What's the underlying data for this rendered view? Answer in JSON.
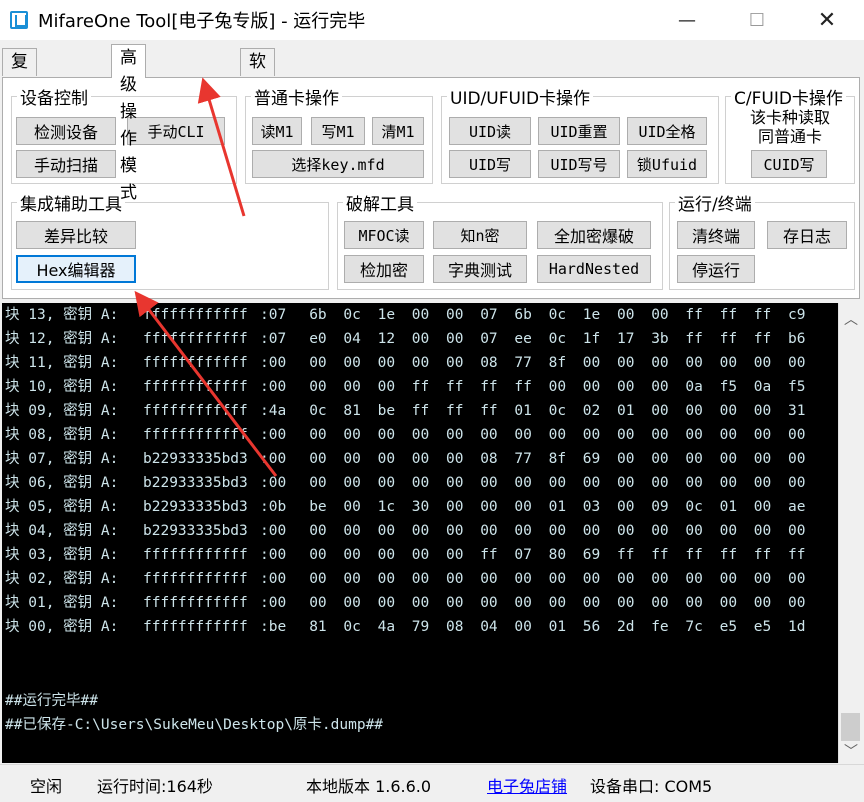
{
  "window": {
    "title": "MifareOne Tool[电子兔专版] - 运行完毕",
    "minimize": "—",
    "maximize": "☐",
    "close": "✕"
  },
  "tabs": [
    {
      "label": "复制卡模式"
    },
    {
      "label": "高级操作模式"
    },
    {
      "label": "软件设置"
    }
  ],
  "groups": {
    "device": {
      "title": "设备控制",
      "buttons": [
        "检测设备",
        "手动CLI",
        "手动扫描"
      ]
    },
    "normal": {
      "title": "普通卡操作",
      "buttons": [
        "读M1",
        "写M1",
        "清M1",
        "选择key.mfd"
      ]
    },
    "uid": {
      "title": "UID/UFUID卡操作",
      "buttons": [
        "UID读",
        "UID重置",
        "UID全格",
        "UID写",
        "UID写号",
        "锁Ufuid"
      ]
    },
    "cfuid": {
      "title": "C/FUID卡操作",
      "note_line1": "该卡种读取",
      "note_line2": "同普通卡",
      "button": "CUID写"
    },
    "tools": {
      "title": "集成辅助工具",
      "buttons": [
        "差异比较",
        "Hex编辑器"
      ]
    },
    "crack": {
      "title": "破解工具",
      "buttons": [
        "MFOC读",
        "知n密",
        "全加密爆破",
        "检加密",
        "字典测试",
        "HardNested"
      ]
    },
    "run": {
      "title": "运行/终端",
      "buttons": [
        "清终端",
        "存日志",
        "停运行"
      ]
    }
  },
  "console": {
    "rows": [
      {
        "label": "块 13, 密钥 A:",
        "key": "ffffffffffff",
        "bytes": [
          ":07",
          "6b",
          "0c",
          "1e",
          "00",
          "00",
          "07",
          "6b",
          "0c",
          "1e",
          "00",
          "00",
          "ff",
          "ff",
          "ff",
          "c9"
        ]
      },
      {
        "label": "块 12, 密钥 A:",
        "key": "ffffffffffff",
        "bytes": [
          ":07",
          "e0",
          "04",
          "12",
          "00",
          "00",
          "07",
          "ee",
          "0c",
          "1f",
          "17",
          "3b",
          "ff",
          "ff",
          "ff",
          "b6"
        ]
      },
      {
        "label": "块 11, 密钥 A:",
        "key": "ffffffffffff",
        "bytes": [
          ":00",
          "00",
          "00",
          "00",
          "00",
          "00",
          "08",
          "77",
          "8f",
          "00",
          "00",
          "00",
          "00",
          "00",
          "00",
          "00"
        ]
      },
      {
        "label": "块 10, 密钥 A:",
        "key": "ffffffffffff",
        "bytes": [
          ":00",
          "00",
          "00",
          "00",
          "ff",
          "ff",
          "ff",
          "ff",
          "00",
          "00",
          "00",
          "00",
          "0a",
          "f5",
          "0a",
          "f5"
        ]
      },
      {
        "label": "块 09, 密钥 A:",
        "key": "ffffffffffff",
        "bytes": [
          ":4a",
          "0c",
          "81",
          "be",
          "ff",
          "ff",
          "ff",
          "01",
          "0c",
          "02",
          "01",
          "00",
          "00",
          "00",
          "00",
          "31"
        ]
      },
      {
        "label": "块 08, 密钥 A:",
        "key": "ffffffffffff",
        "bytes": [
          ":00",
          "00",
          "00",
          "00",
          "00",
          "00",
          "00",
          "00",
          "00",
          "00",
          "00",
          "00",
          "00",
          "00",
          "00",
          "00"
        ]
      },
      {
        "label": "块 07, 密钥 A:",
        "key": "b22933335bd3",
        "bytes": [
          ":00",
          "00",
          "00",
          "00",
          "00",
          "00",
          "08",
          "77",
          "8f",
          "69",
          "00",
          "00",
          "00",
          "00",
          "00",
          "00"
        ]
      },
      {
        "label": "块 06, 密钥 A:",
        "key": "b22933335bd3",
        "bytes": [
          ":00",
          "00",
          "00",
          "00",
          "00",
          "00",
          "00",
          "00",
          "00",
          "00",
          "00",
          "00",
          "00",
          "00",
          "00",
          "00"
        ]
      },
      {
        "label": "块 05, 密钥 A:",
        "key": "b22933335bd3",
        "bytes": [
          ":0b",
          "be",
          "00",
          "1c",
          "30",
          "00",
          "00",
          "00",
          "01",
          "03",
          "00",
          "09",
          "0c",
          "01",
          "00",
          "ae"
        ]
      },
      {
        "label": "块 04, 密钥 A:",
        "key": "b22933335bd3",
        "bytes": [
          ":00",
          "00",
          "00",
          "00",
          "00",
          "00",
          "00",
          "00",
          "00",
          "00",
          "00",
          "00",
          "00",
          "00",
          "00",
          "00"
        ]
      },
      {
        "label": "块 03, 密钥 A:",
        "key": "ffffffffffff",
        "bytes": [
          ":00",
          "00",
          "00",
          "00",
          "00",
          "00",
          "ff",
          "07",
          "80",
          "69",
          "ff",
          "ff",
          "ff",
          "ff",
          "ff",
          "ff"
        ]
      },
      {
        "label": "块 02, 密钥 A:",
        "key": "ffffffffffff",
        "bytes": [
          ":00",
          "00",
          "00",
          "00",
          "00",
          "00",
          "00",
          "00",
          "00",
          "00",
          "00",
          "00",
          "00",
          "00",
          "00",
          "00"
        ]
      },
      {
        "label": "块 01, 密钥 A:",
        "key": "ffffffffffff",
        "bytes": [
          ":00",
          "00",
          "00",
          "00",
          "00",
          "00",
          "00",
          "00",
          "00",
          "00",
          "00",
          "00",
          "00",
          "00",
          "00",
          "00"
        ]
      },
      {
        "label": "块 00, 密钥 A:",
        "key": "ffffffffffff",
        "bytes": [
          ":be",
          "81",
          "0c",
          "4a",
          "79",
          "08",
          "04",
          "00",
          "01",
          "56",
          "2d",
          "fe",
          "7c",
          "e5",
          "e5",
          "1d"
        ]
      }
    ],
    "done_line": "##运行完毕##",
    "saved_line": "##已保存-C:\\Users\\SukeMeu\\Desktop\\原卡.dump##"
  },
  "status": {
    "state": "空闲",
    "runtime": "运行时间:164秒",
    "version": "本地版本 1.6.6.0",
    "shop_link": "电子兔店铺",
    "port": "设备串口: COM5"
  },
  "colors": {
    "console_bg": "#000000",
    "console_fg": "#cde4ea",
    "arrow": "#e8362f",
    "focus": "#0078d7"
  }
}
